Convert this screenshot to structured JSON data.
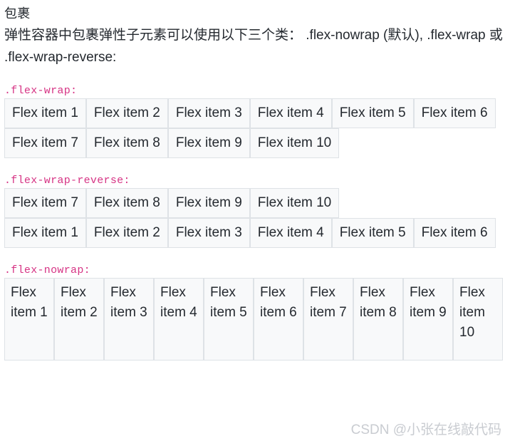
{
  "document": {
    "heading": "包裹",
    "intro_paragraph": "弹性容器中包裹弹性子元素可以使用以下三个类： .flex-nowrap (默认), .flex-wrap 或 .flex-wrap-reverse:"
  },
  "sections": [
    {
      "code_label": ".flex-wrap:",
      "mode": "wrap",
      "items": [
        "Flex item 1",
        "Flex item 2",
        "Flex item 3",
        "Flex item 4",
        "Flex item 5",
        "Flex item 6",
        "Flex item 7",
        "Flex item 8",
        "Flex item 9",
        "Flex item 10"
      ]
    },
    {
      "code_label": ".flex-wrap-reverse:",
      "mode": "wrap-reverse",
      "items": [
        "Flex item 1",
        "Flex item 2",
        "Flex item 3",
        "Flex item 4",
        "Flex item 5",
        "Flex item 6",
        "Flex item 7",
        "Flex item 8",
        "Flex item 9",
        "Flex item 10"
      ]
    },
    {
      "code_label": ".flex-nowrap:",
      "mode": "nowrap",
      "items": [
        "Flex item 1",
        "Flex item 2",
        "Flex item 3",
        "Flex item 4",
        "Flex item 5",
        "Flex item 6",
        "Flex item 7",
        "Flex item 8",
        "Flex item 9",
        "Flex item 10"
      ]
    }
  ],
  "watermark": {
    "text": "CSDN @小张在线敲代码"
  },
  "colors": {
    "code_accent": "#d63384",
    "item_background": "#f8f9fa",
    "item_border": "#dee2e6",
    "body_text": "#24292f",
    "watermark_text": "#c9ccd1"
  }
}
